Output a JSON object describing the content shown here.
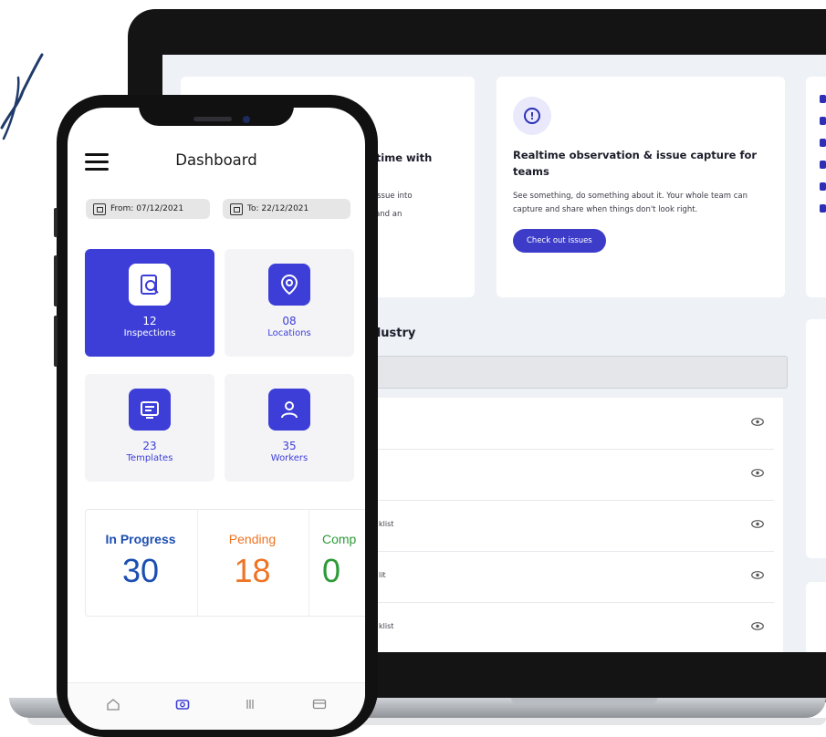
{
  "phone": {
    "header": {
      "title": "Dashboard"
    },
    "dates": {
      "from": "From: 07/12/2021",
      "to": "To: 22/12/2021"
    },
    "tiles": [
      {
        "count": "12",
        "label": "Inspections",
        "icon": "inspection-icon",
        "active": true
      },
      {
        "count": "08",
        "label": "Locations",
        "icon": "location-pin-icon",
        "active": false
      },
      {
        "count": "23",
        "label": "Templates",
        "icon": "template-icon",
        "active": false
      },
      {
        "count": "35",
        "label": "Workers",
        "icon": "worker-icon",
        "active": false
      }
    ],
    "status": [
      {
        "label": "In Progress",
        "value": "30",
        "color": "#1c4fb1"
      },
      {
        "label": "Pending",
        "value": "18",
        "color": "#ee7423"
      },
      {
        "label": "Comp",
        "value": "0",
        "color": "#2e9a39"
      }
    ],
    "bottom_nav": [
      "home-icon",
      "camera-icon",
      "list-icon",
      "card-icon"
    ],
    "accent": "#3d3ed8"
  },
  "laptop": {
    "card_left": {
      "title": "- time with",
      "line1": "y issue into",
      "line2": "n and an"
    },
    "card_middle": {
      "icon": "info-icon",
      "icon_glyph": "!",
      "title": "Realtime observation & issue capture for teams",
      "body": "See something, do something about it. Your whole team can capture and share when things don't look right.",
      "button": "Check out issues"
    },
    "section_heading": "dustry",
    "rows": [
      {
        "label": ""
      },
      {
        "label": ""
      },
      {
        "label": "klist"
      },
      {
        "label": "lit"
      },
      {
        "label": "klist"
      }
    ],
    "button_color": "#3c3cc9"
  }
}
